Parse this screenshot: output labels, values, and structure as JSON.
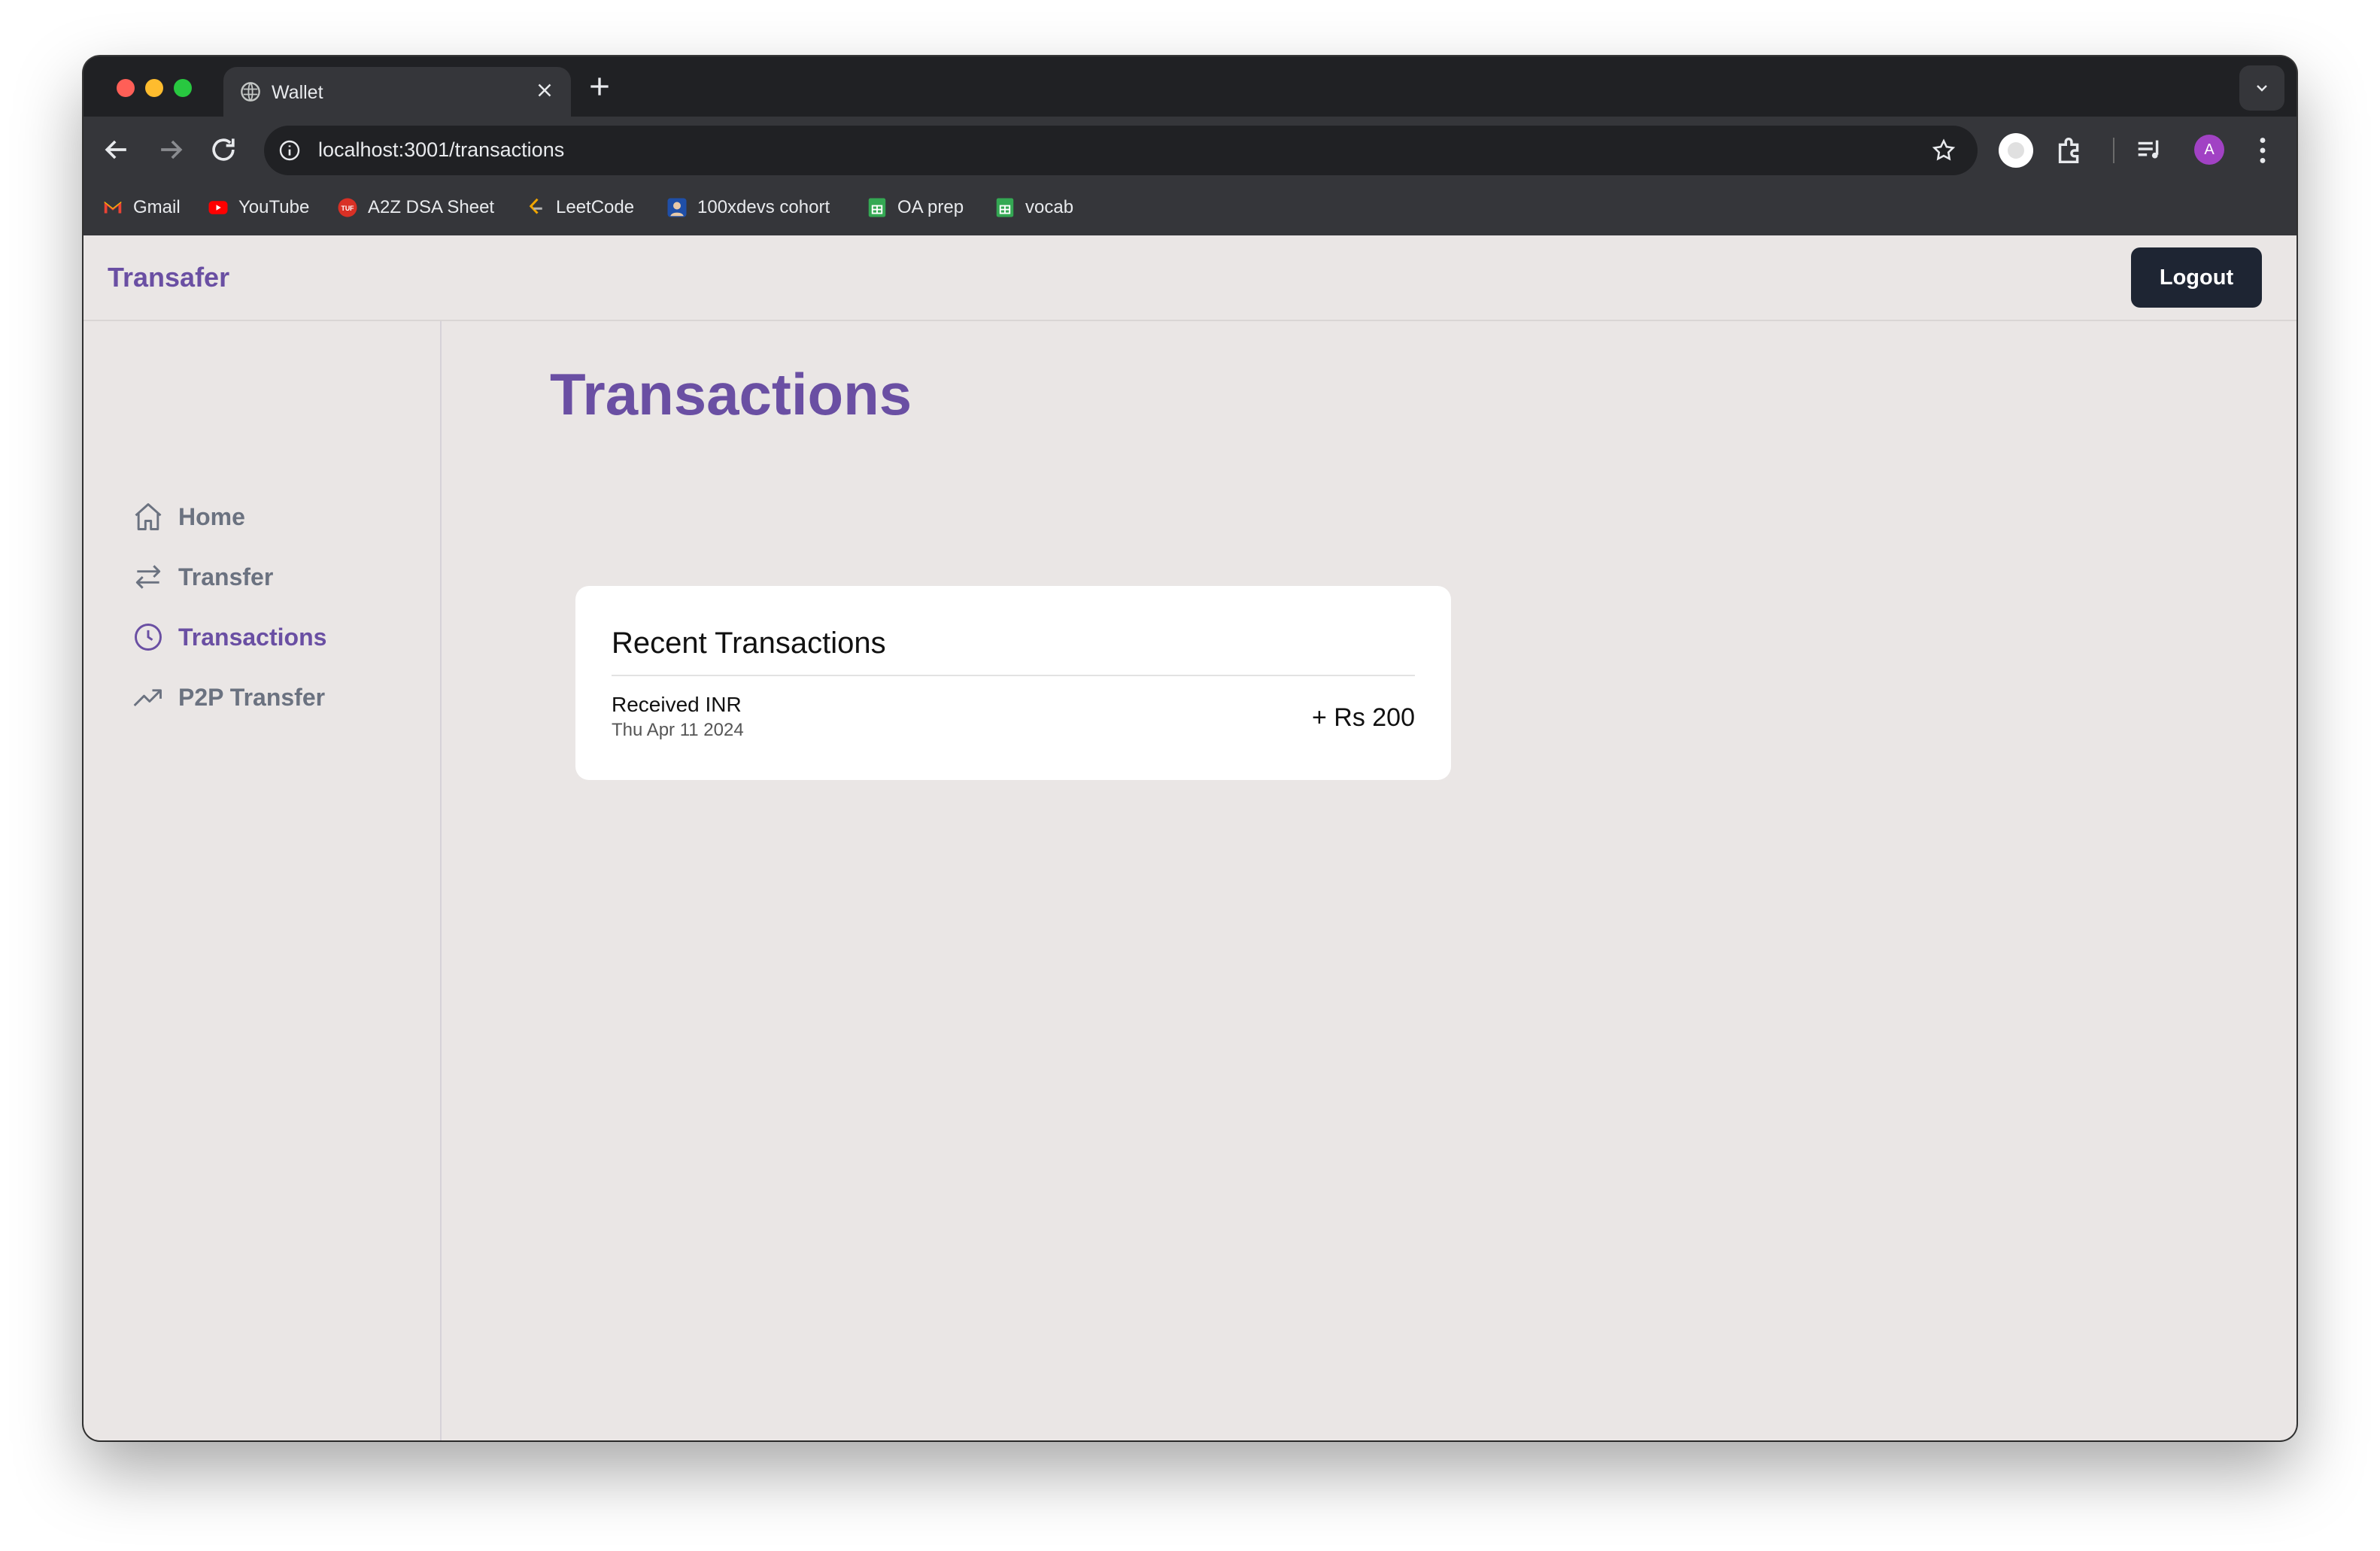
{
  "browser": {
    "tab_title": "Wallet",
    "url": "localhost:3001/transactions",
    "profile_initial": "A",
    "bookmarks": [
      {
        "label": "Gmail",
        "icon": "gmail-icon"
      },
      {
        "label": "YouTube",
        "icon": "youtube-icon"
      },
      {
        "label": "A2Z DSA Sheet",
        "icon": "tuf-icon"
      },
      {
        "label": "LeetCode",
        "icon": "leetcode-icon"
      },
      {
        "label": "100xdevs cohort",
        "icon": "cohort-icon"
      },
      {
        "label": "OA prep",
        "icon": "sheets-icon"
      },
      {
        "label": "vocab",
        "icon": "sheets-icon"
      }
    ]
  },
  "app": {
    "brand": "Transafer",
    "logout_label": "Logout",
    "accent_color": "#6a4fa3"
  },
  "sidebar": {
    "items": [
      {
        "label": "Home",
        "icon": "home-icon",
        "active": false
      },
      {
        "label": "Transfer",
        "icon": "transfer-arrows-icon",
        "active": false
      },
      {
        "label": "Transactions",
        "icon": "clock-icon",
        "active": true
      },
      {
        "label": "P2P Transfer",
        "icon": "trending-up-icon",
        "active": false
      }
    ]
  },
  "main": {
    "title": "Transactions",
    "card": {
      "title": "Recent Transactions",
      "transactions": [
        {
          "label": "Received INR",
          "date": "Thu Apr 11 2024",
          "amount": "+ Rs 200"
        }
      ]
    }
  }
}
